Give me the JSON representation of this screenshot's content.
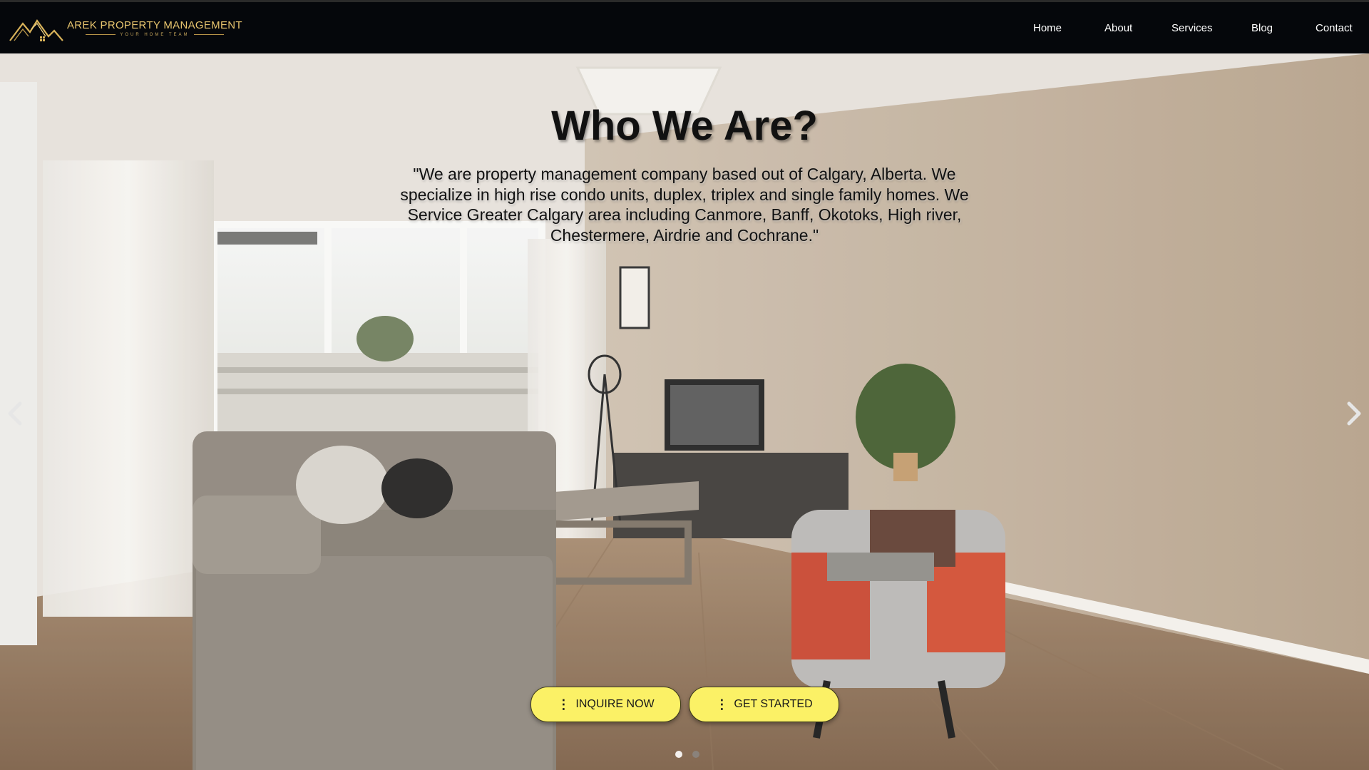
{
  "brand": {
    "name": "AREK PROPERTY MANAGEMENT",
    "tagline": "YOUR HOME TEAM"
  },
  "nav": {
    "items": [
      {
        "label": "Home"
      },
      {
        "label": "About"
      },
      {
        "label": "Services"
      },
      {
        "label": "Blog"
      },
      {
        "label": "Contact"
      }
    ]
  },
  "hero": {
    "title": "Who We Are?",
    "text": "\"We are property management company based out of Calgary, Alberta. We specialize in high rise condo units, duplex, triplex and single family homes. We Service Greater Calgary area including Canmore, Banff, Okotoks, High river, Chestermere, Airdrie and Cochrane.\"",
    "buttons": {
      "inquire": "INQUIRE NOW",
      "started": "GET STARTED"
    },
    "prev_icon": "chevron-left-icon",
    "next_icon": "chevron-right-icon",
    "slides_total": 2,
    "slide_active": 1
  },
  "colors": {
    "nav_bg": "#05070b",
    "brand_gold": "#e9c66f",
    "button_yellow": "#fbf166"
  }
}
